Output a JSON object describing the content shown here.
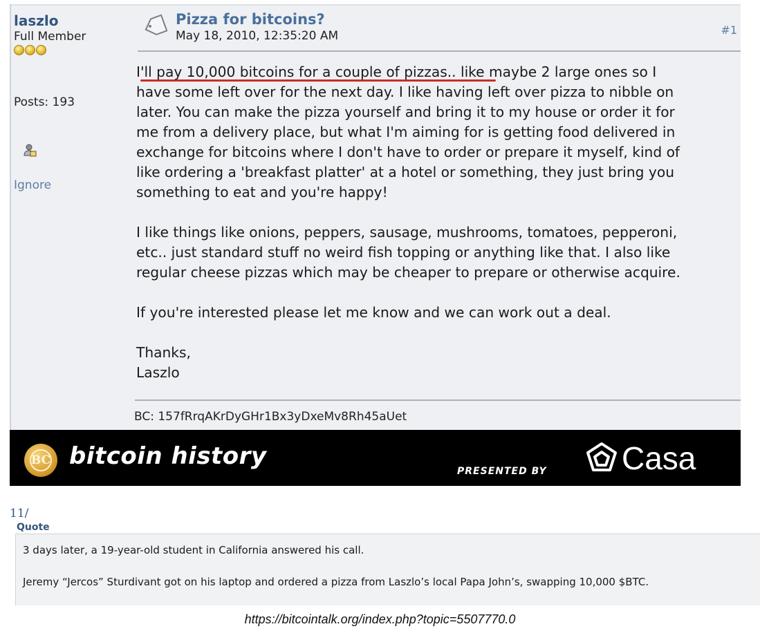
{
  "poster": {
    "name": "laszlo",
    "rank": "Full Member",
    "posts": "Posts: 193",
    "ignore": "Ignore",
    "profile_icon": "user-icon"
  },
  "post": {
    "title": "Pizza for bitcoins?",
    "date": "May 18, 2010, 12:35:20 AM",
    "number": "#1",
    "paragraphs": [
      [
        "I'll pay 10,000 bitcoins for a couple of pizzas.. like maybe 2 large ones so I",
        "have some left over for the next day.  I like having left over pizza to nibble on",
        "later.  You can make the pizza yourself and bring it to my house or order it for",
        "me from a delivery place, but what I'm aiming for is getting food delivered in",
        "exchange for bitcoins where I don't have to order or prepare it myself, kind of",
        "like ordering a 'breakfast platter' at a hotel or something, they just bring you",
        "something to eat and you're happy!"
      ],
      [
        "I like things like onions, peppers, sausage, mushrooms, tomatoes, pepperoni,",
        "etc.. just standard stuff no weird fish topping or anything like that.  I also like",
        "regular cheese pizzas which may be cheaper to prepare or otherwise acquire."
      ],
      [
        "If you're interested please let me know and we can work out a deal."
      ],
      [
        "Thanks,",
        "Laszlo"
      ]
    ],
    "signature": "BC: 157fRrqAKrDyGHr1Bx3yDxeMv8Rh45aUet"
  },
  "banner": {
    "coin_text": "BC",
    "title": "bitcoin history",
    "presented_by": "PRESENTED BY",
    "sponsor": "Casa"
  },
  "thread_number": "11/",
  "quote": {
    "label": "Quote",
    "lines": [
      "3 days later, a 19-year-old student in California answered his call.",
      "Jeremy “Jercos” Sturdivant got on his laptop and ordered a pizza from Laszlo’s local Papa John’s, swapping 10,000 $BTC."
    ]
  },
  "source_url": "https://bitcointalk.org/index.php?topic=5507770.0",
  "colors": {
    "username": "#35557f",
    "title": "#4a6f9c",
    "highlight_underline": "#cf2b21",
    "panel_bg": "#eef0f3",
    "banner_bg": "#000000"
  }
}
